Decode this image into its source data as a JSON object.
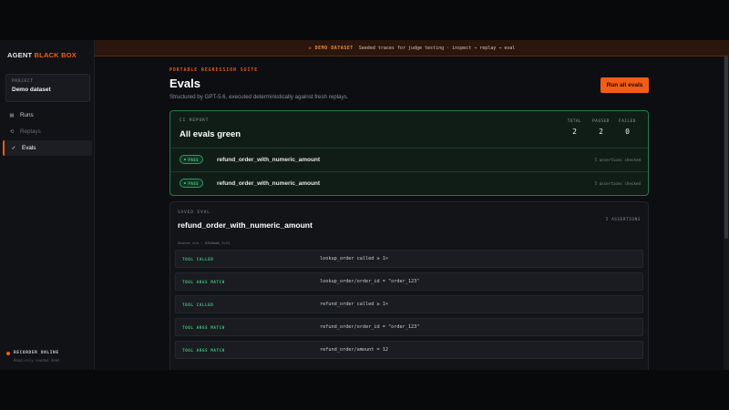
{
  "sidebar": {
    "brand_part1": "AGENT",
    "brand_part2": "BLACK BOX",
    "project_label": "PROJECT",
    "project_name": "Demo dataset",
    "nav": [
      {
        "label": "Runs",
        "icon": "grid-icon"
      },
      {
        "label": "Replays",
        "icon": "replay-icon"
      },
      {
        "label": "Evals",
        "icon": "check-icon"
      }
    ],
    "recorder_status": "RECORDER ONLINE",
    "recorder_sub": "Read-only seeded demo"
  },
  "banner": {
    "tag": "◇ DEMO DATASET",
    "text": "Seeded traces for judge testing · inspect → replay → eval"
  },
  "header": {
    "eyebrow": "PORTABLE REGRESSION SUITE",
    "title": "Evals",
    "subtitle": "Structured by GPT-5.6, executed deterministically against fresh replays.",
    "run_button": "Run all evals"
  },
  "ci_report": {
    "label": "CI REPORT",
    "status": "All evals green",
    "stats": [
      {
        "label": "TOTAL",
        "value": "2"
      },
      {
        "label": "PASSED",
        "value": "2"
      },
      {
        "label": "FAILED",
        "value": "0"
      }
    ],
    "rows": [
      {
        "badge": "PASS",
        "name": "refund_order_with_numeric_amount",
        "checked": "5 assertions checked"
      },
      {
        "badge": "PASS",
        "name": "refund_order_with_numeric_amount",
        "checked": "5 assertions checked"
      }
    ]
  },
  "saved_eval": {
    "label": "SAVED EVAL",
    "name": "refund_order_with_numeric_amount",
    "count": "5 ASSERTIONS",
    "source": "Source run · 07b6aa8_7c31",
    "assertions": [
      {
        "kind": "TOOL CALLED",
        "expr": "lookup_order called ≥ 1×"
      },
      {
        "kind": "TOOL ARGS MATCH",
        "expr": "lookup_order/order_id = \"order_123\""
      },
      {
        "kind": "TOOL CALLED",
        "expr": "refund_order called ≥ 1×"
      },
      {
        "kind": "TOOL ARGS MATCH",
        "expr": "refund_order/order_id = \"order_123\""
      },
      {
        "kind": "TOOL ARGS MATCH",
        "expr": "refund_order/amount = 12"
      }
    ]
  },
  "colors": {
    "accent": "#f25c19",
    "pass": "#4ad17f",
    "background": "#0d0e11"
  }
}
